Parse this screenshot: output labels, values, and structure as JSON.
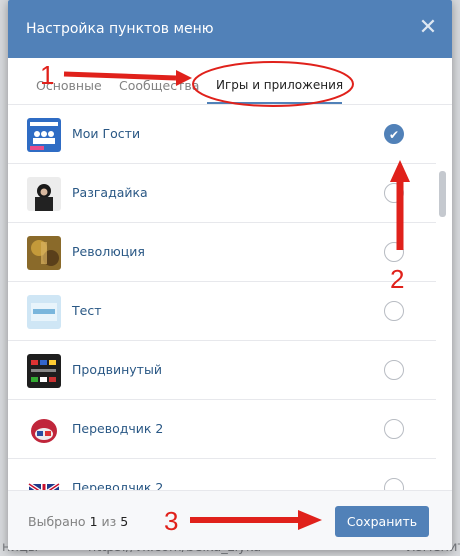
{
  "background": {
    "left_text_1": "ницы",
    "left_text_2": "https://vk.com/belka_zlyka",
    "right_text": "Изменить"
  },
  "dialog": {
    "title": "Настройка пунктов меню",
    "close_icon": "close-icon"
  },
  "tabs": [
    {
      "label": "Основные",
      "active": false
    },
    {
      "label": "Сообщества",
      "active": false
    },
    {
      "label": "Игры и приложения",
      "active": true
    }
  ],
  "apps": [
    {
      "name": "Мои Гости",
      "checked": true
    },
    {
      "name": "Разгадайка",
      "checked": false
    },
    {
      "name": "Революция",
      "checked": false
    },
    {
      "name": "Тест",
      "checked": false
    },
    {
      "name": "Продвинутый",
      "checked": false
    },
    {
      "name": "Переводчик 2",
      "checked": false
    },
    {
      "name": "Переводчик 2",
      "checked": false
    }
  ],
  "footer": {
    "counter_prefix": "Выбрано",
    "counter_selected": "1",
    "counter_mid": "из",
    "counter_total": "5",
    "save_label": "Сохранить"
  },
  "annotations": {
    "n1": "1",
    "n2": "2",
    "n3": "3"
  },
  "colors": {
    "accent": "#5181b8",
    "annotation_red": "#e0211b"
  }
}
